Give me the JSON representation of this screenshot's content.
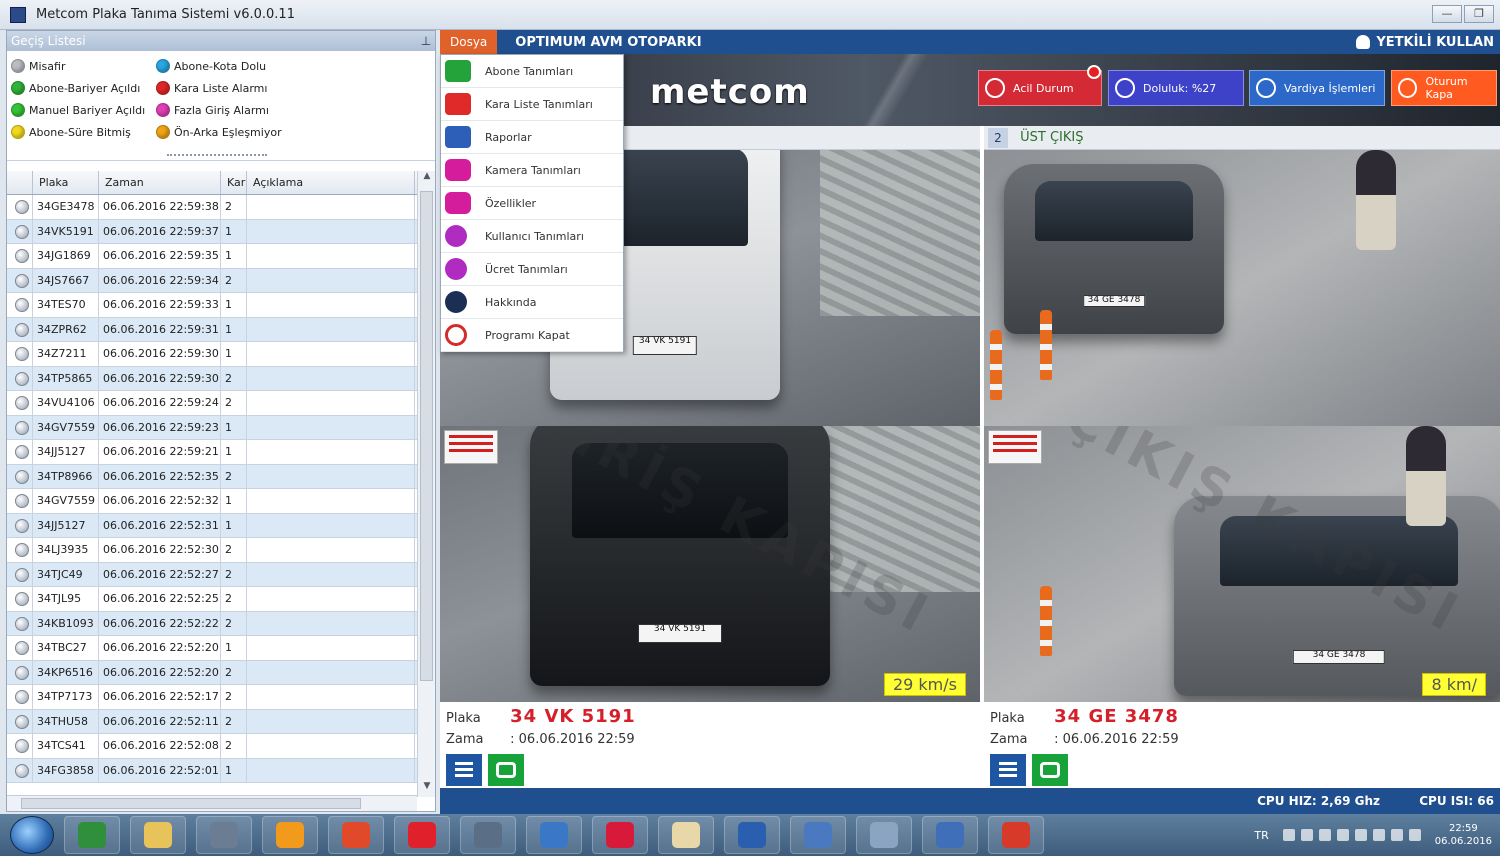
{
  "window": {
    "title": "Metcom Plaka Tanıma Sistemi   v6.0.0.11",
    "minimize_label": "—",
    "restore_label": "❐"
  },
  "left_panel": {
    "title": "Geçiş Listesi",
    "legend": [
      {
        "label": "Misafir",
        "color": "#b9bdc3"
      },
      {
        "label": "Abone-Kota Dolu",
        "color": "#2aa6e0"
      },
      {
        "label": "Abone-Bariyer Açıldı",
        "color": "#2fb33a"
      },
      {
        "label": "Kara Liste Alarmı",
        "color": "#e02727"
      },
      {
        "label": "Manuel Bariyer Açıldı",
        "color": "#38c23a"
      },
      {
        "label": "Fazla Giriş Alarmı",
        "color": "#e13fb5"
      },
      {
        "label": "Abone-Süre Bitmiş",
        "color": "#f2d81e"
      },
      {
        "label": "Ön-Arka Eşleşmiyor",
        "color": "#f0a417"
      }
    ],
    "columns": [
      "",
      "Plaka",
      "Zaman",
      "Kar",
      "Açıklama"
    ],
    "rows": [
      {
        "plate": "34GE3478",
        "time": "06.06.2016 22:59:38",
        "lane": "2"
      },
      {
        "plate": "34VK5191",
        "time": "06.06.2016 22:59:37",
        "lane": "1"
      },
      {
        "plate": "34JG1869",
        "time": "06.06.2016 22:59:35",
        "lane": "1"
      },
      {
        "plate": "34JS7667",
        "time": "06.06.2016 22:59:34",
        "lane": "2"
      },
      {
        "plate": "34TES70",
        "time": "06.06.2016 22:59:33",
        "lane": "1"
      },
      {
        "plate": "34ZPR62",
        "time": "06.06.2016 22:59:31",
        "lane": "1"
      },
      {
        "plate": "34Z7211",
        "time": "06.06.2016 22:59:30",
        "lane": "1"
      },
      {
        "plate": "34TP5865",
        "time": "06.06.2016 22:59:30",
        "lane": "2"
      },
      {
        "plate": "34VU4106",
        "time": "06.06.2016 22:59:24",
        "lane": "2"
      },
      {
        "plate": "34GV7559",
        "time": "06.06.2016 22:59:23",
        "lane": "1"
      },
      {
        "plate": "34JJ5127",
        "time": "06.06.2016 22:59:21",
        "lane": "1"
      },
      {
        "plate": "34TP8966",
        "time": "06.06.2016 22:52:35",
        "lane": "2"
      },
      {
        "plate": "34GV7559",
        "time": "06.06.2016 22:52:32",
        "lane": "1"
      },
      {
        "plate": "34JJ5127",
        "time": "06.06.2016 22:52:31",
        "lane": "1"
      },
      {
        "plate": "34LJ3935",
        "time": "06.06.2016 22:52:30",
        "lane": "2"
      },
      {
        "plate": "34TJC49",
        "time": "06.06.2016 22:52:27",
        "lane": "2"
      },
      {
        "plate": "34TJL95",
        "time": "06.06.2016 22:52:25",
        "lane": "2"
      },
      {
        "plate": "34KB1093",
        "time": "06.06.2016 22:52:22",
        "lane": "2"
      },
      {
        "plate": "34TBC27",
        "time": "06.06.2016 22:52:20",
        "lane": "1"
      },
      {
        "plate": "34KP6516",
        "time": "06.06.2016 22:52:20",
        "lane": "2"
      },
      {
        "plate": "34TP7173",
        "time": "06.06.2016 22:52:17",
        "lane": "2"
      },
      {
        "plate": "34THU58",
        "time": "06.06.2016 22:52:11",
        "lane": "2"
      },
      {
        "plate": "34TCS41",
        "time": "06.06.2016 22:52:08",
        "lane": "2"
      },
      {
        "plate": "34FG3858",
        "time": "06.06.2016 22:52:01",
        "lane": "1"
      }
    ]
  },
  "menubar": {
    "file_menu": "Dosya",
    "facility": "OPTIMUM AVM OTOPARKI",
    "user": "YETKİLİ KULLAN"
  },
  "banner": {
    "logo": "metcom",
    "buttons": {
      "emergency": "Acil Durum",
      "occupancy": "Doluluk: %27",
      "shift": "Vardiya İşlemleri",
      "logout": "Oturum Kapa"
    }
  },
  "file_menu_items": [
    {
      "label": "Abone Tanımları",
      "icon": "car-icon-green"
    },
    {
      "label": "Kara Liste Tanımları",
      "icon": "car-icon-red"
    },
    {
      "label": "Raporlar",
      "icon": "document-icon"
    },
    {
      "label": "Kamera Tanımları",
      "icon": "camera-icon"
    },
    {
      "label": "Özellikler",
      "icon": "gear-icon"
    },
    {
      "label": "Kullanıcı Tanımları",
      "icon": "user-icon"
    },
    {
      "label": "Ücret Tanımları",
      "icon": "lira-icon"
    },
    {
      "label": "Hakkında",
      "icon": "info-icon"
    },
    {
      "label": "Programı Kapat",
      "icon": "power-icon"
    }
  ],
  "cameras": {
    "right_header_number": "2",
    "right_header_label": "ÜST ÇIKIŞ",
    "left": {
      "speed": "29 km/s",
      "plate_label": "Plaka",
      "plate_value": "34 VK 5191",
      "time_label": "Zama",
      "time_value": ": 06.06.2016 22:59",
      "watermark": "GİRİŞ KAPISI",
      "plate_text_top": "34 VK 5191",
      "plate_text_bottom": "34 VK 5191"
    },
    "right": {
      "speed": "8 km/",
      "plate_label": "Plaka",
      "plate_value": "34 GE 3478",
      "time_label": "Zama",
      "time_value": ": 06.06.2016 22:59",
      "watermark": "ÇIKIŞ KAPISI",
      "plate_text_top": "34 GE 3478",
      "plate_text_bottom": "34 GE 3478"
    }
  },
  "status": {
    "cpu_speed": "CPU HIZ: 2,69 Ghz",
    "cpu_load": "CPU ISI: 66"
  },
  "taskbar": {
    "lang": "TR",
    "time": "22:59",
    "date": "06.06.2016",
    "apps": [
      "#2f8f3a",
      "#e7c35a",
      "#6a7d92",
      "#f29a1c",
      "#e04a2a",
      "#e0202a",
      "#5a6e86",
      "#3b77c7",
      "#d81a3a",
      "#e8d7a8",
      "#2a5fb0",
      "#4a79c0",
      "#8aa4c2",
      "#3e6fb8",
      "#d83a2a"
    ]
  }
}
